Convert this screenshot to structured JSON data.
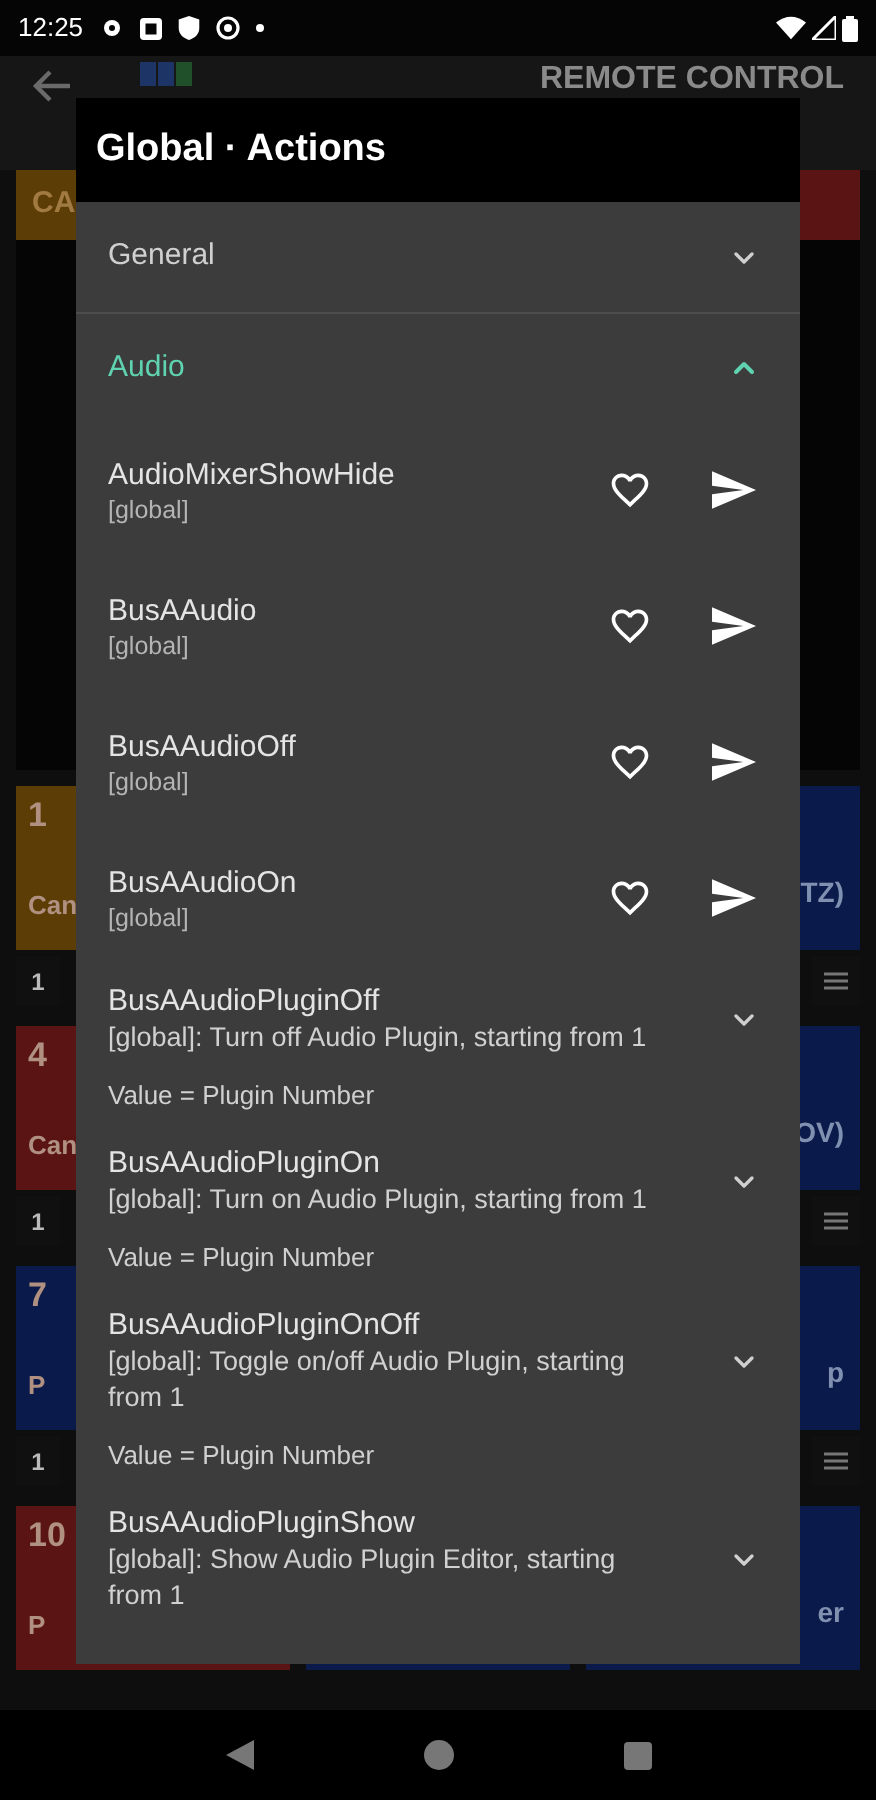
{
  "status_bar": {
    "time": "12:25"
  },
  "background": {
    "header_title": "REMOTE CONTROL",
    "top_label": "CA",
    "tile_rows": [
      {
        "left_number": "1",
        "left_label": "Can",
        "right_label": "TZ)",
        "footer_value": "1"
      },
      {
        "left_number": "4",
        "left_label": "Can",
        "right_label": "OV)",
        "footer_value": "1"
      },
      {
        "left_number": "7",
        "left_label": "P",
        "right_label": "p",
        "footer_value": "1"
      },
      {
        "left_number": "10",
        "left_label": "P",
        "right_label": "er"
      }
    ]
  },
  "dialog": {
    "title": "Global · Actions",
    "categories": [
      {
        "label": "General",
        "expanded": false
      },
      {
        "label": "Audio",
        "expanded": true,
        "actions": [
          {
            "kind": "simple",
            "name": "AudioMixerShowHide",
            "scope": "[global]"
          },
          {
            "kind": "simple",
            "name": "BusAAudio",
            "scope": "[global]"
          },
          {
            "kind": "simple",
            "name": "BusAAudioOff",
            "scope": "[global]"
          },
          {
            "kind": "simple",
            "name": "BusAAudioOn",
            "scope": "[global]"
          },
          {
            "kind": "parameter",
            "name": "BusAAudioPluginOff",
            "description": "[global]: Turn off Audio Plugin, starting from 1",
            "value_note": "Value = Plugin Number"
          },
          {
            "kind": "parameter",
            "name": "BusAAudioPluginOn",
            "description": "[global]: Turn on Audio Plugin, starting from 1",
            "value_note": "Value = Plugin Number"
          },
          {
            "kind": "parameter",
            "name": "BusAAudioPluginOnOff",
            "description": "[global]: Toggle on/off Audio Plugin, starting from 1",
            "value_note": "Value = Plugin Number"
          },
          {
            "kind": "parameter",
            "name": "BusAAudioPluginShow",
            "description": "[global]: Show Audio Plugin Editor, starting from 1"
          }
        ]
      }
    ]
  }
}
